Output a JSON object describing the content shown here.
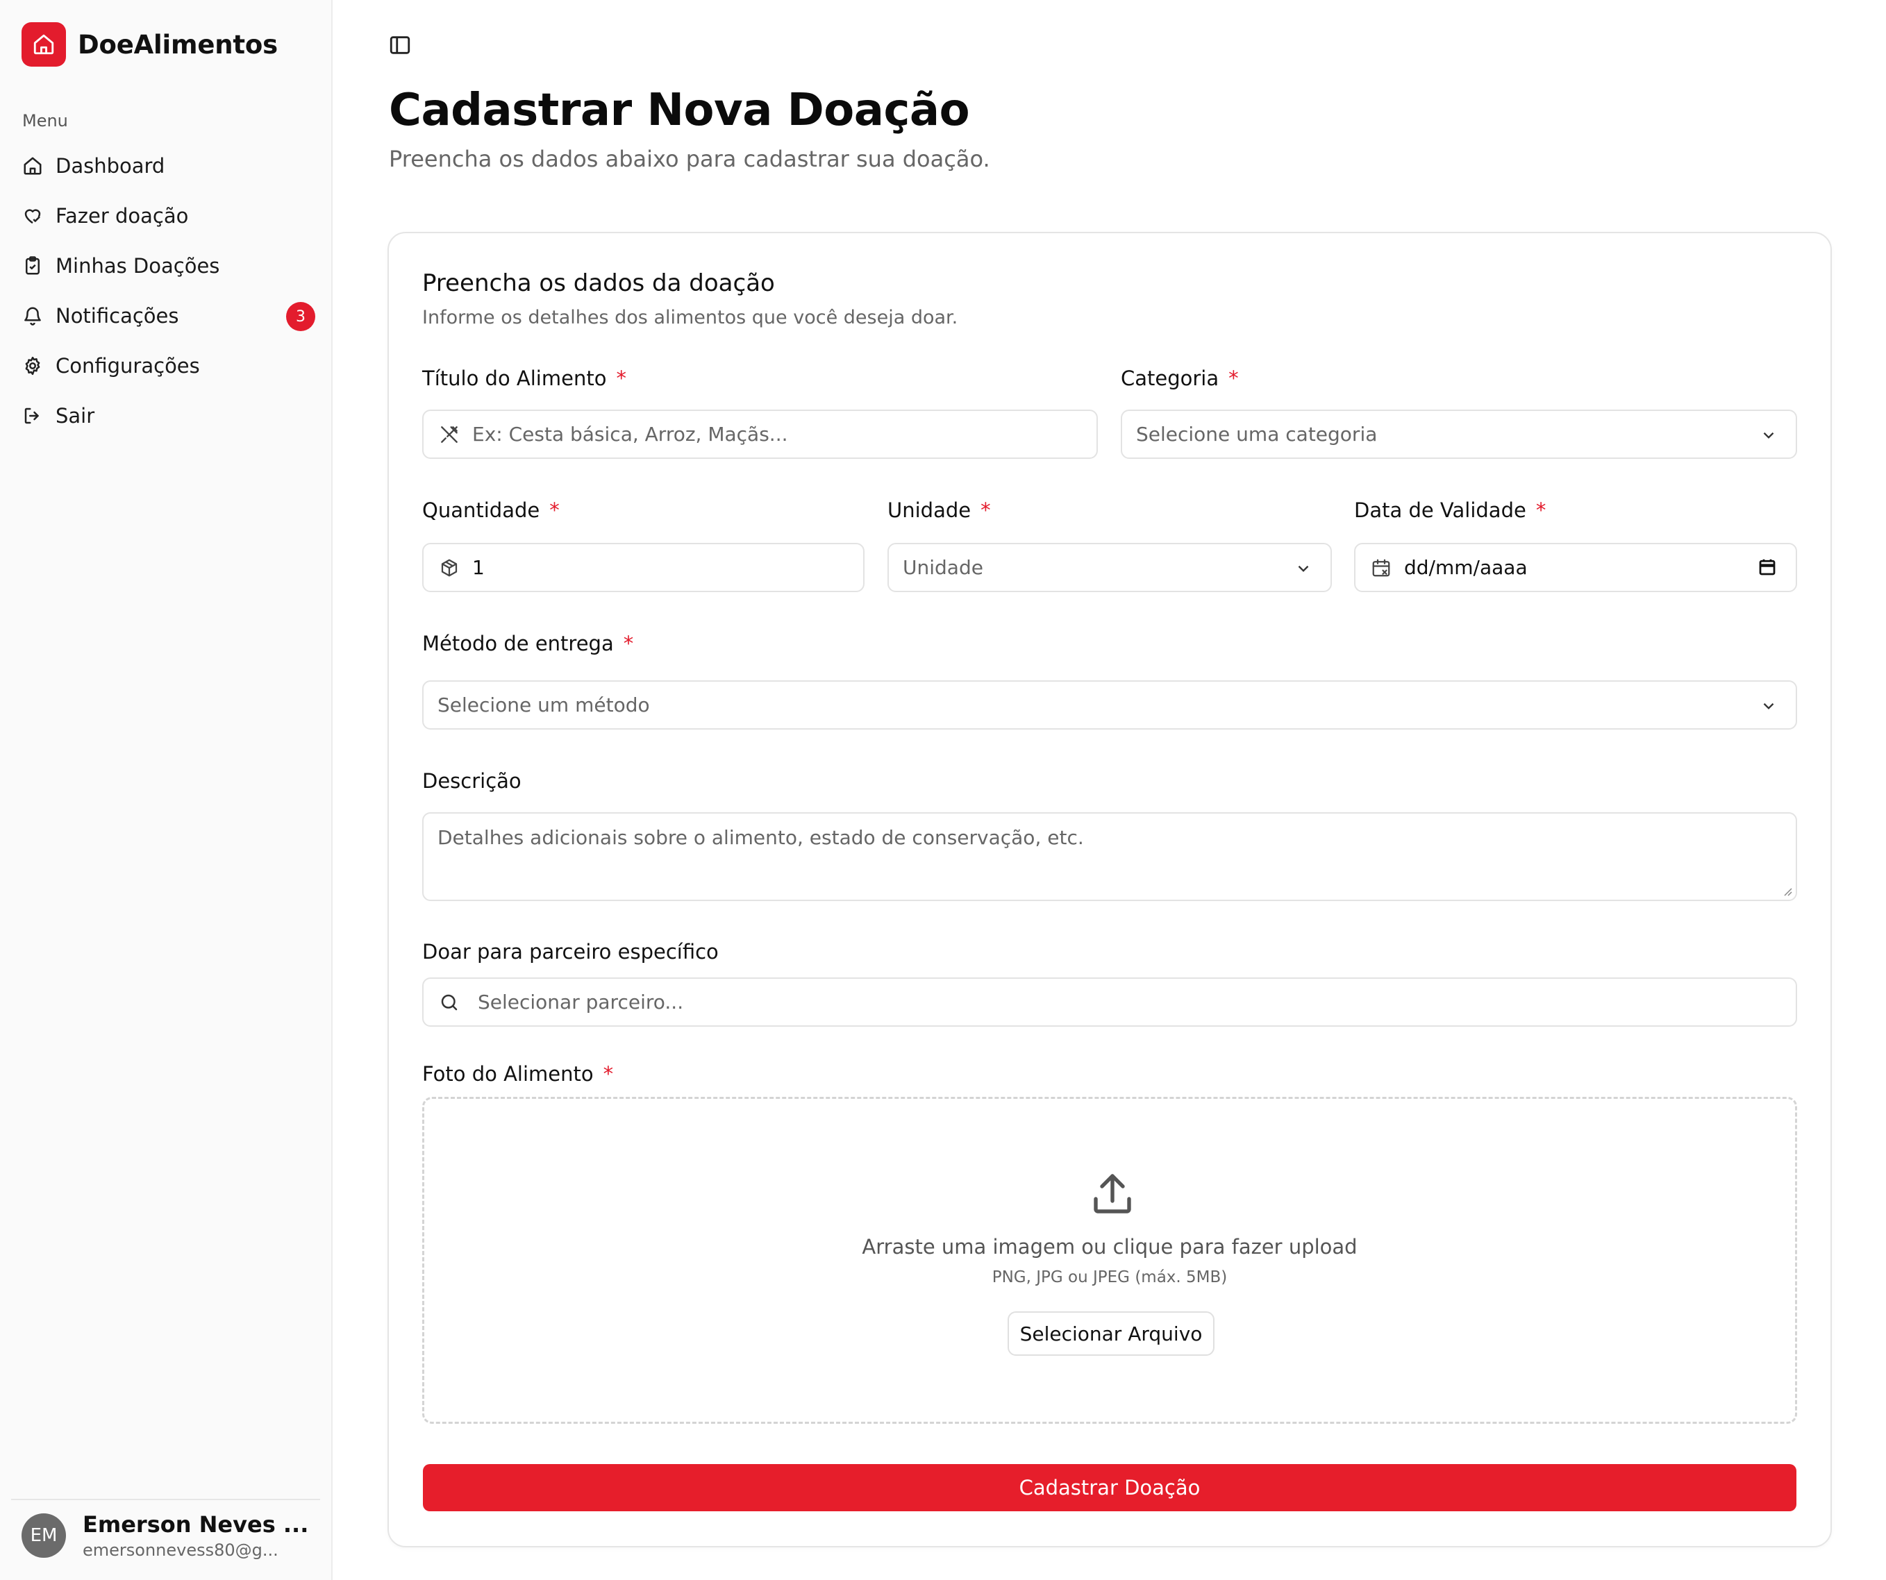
{
  "app": {
    "name": "DoeAlimentos"
  },
  "colors": {
    "brand": "#e31c2d",
    "required": "#e31c2d"
  },
  "sidebar": {
    "menu_label": "Menu",
    "items": [
      {
        "label": "Dashboard",
        "icon": "home-icon"
      },
      {
        "label": "Fazer doação",
        "icon": "heart-hand-icon"
      },
      {
        "label": "Minhas Doações",
        "icon": "clipboard-icon"
      },
      {
        "label": "Notificações",
        "icon": "bell-icon",
        "badge": "3"
      },
      {
        "label": "Configurações",
        "icon": "gear-icon"
      },
      {
        "label": "Sair",
        "icon": "logout-icon"
      }
    ],
    "user": {
      "initials": "EM",
      "name": "Emerson Neves ...",
      "email": "emersonnevess80@g..."
    }
  },
  "page": {
    "title": "Cadastrar Nova Doação",
    "subtitle": "Preencha os dados abaixo para cadastrar sua doação."
  },
  "form": {
    "title": "Preencha os dados da doação",
    "subtitle": "Informe os detalhes dos alimentos que você deseja doar.",
    "required_mark": "*",
    "titulo": {
      "label": "Título do Alimento",
      "placeholder": "Ex: Cesta básica, Arroz, Maçãs..."
    },
    "categoria": {
      "label": "Categoria",
      "placeholder": "Selecione uma categoria"
    },
    "quantidade": {
      "label": "Quantidade",
      "value": "1"
    },
    "unidade": {
      "label": "Unidade",
      "placeholder": "Unidade"
    },
    "validade": {
      "label": "Data de Validade",
      "placeholder": "dd/mm/aaaa"
    },
    "metodo": {
      "label": "Método de entrega",
      "placeholder": "Selecione um método"
    },
    "descricao": {
      "label": "Descrição",
      "placeholder": "Detalhes adicionais sobre o alimento, estado de conservação, etc."
    },
    "parceiro": {
      "label": "Doar para parceiro específico",
      "placeholder": "Selecionar parceiro..."
    },
    "foto": {
      "label": "Foto do Alimento",
      "drop_text": "Arraste uma imagem ou clique para fazer upload",
      "hint": "PNG, JPG ou JPEG (máx. 5MB)",
      "button": "Selecionar Arquivo"
    },
    "submit": "Cadastrar Doação"
  }
}
